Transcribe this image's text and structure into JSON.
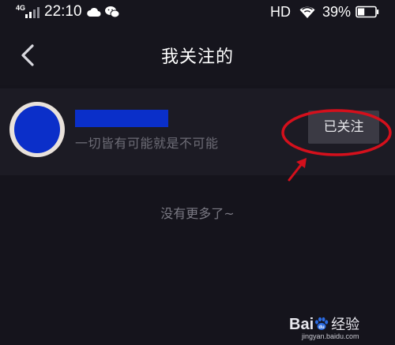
{
  "status_bar": {
    "network": "4G",
    "time": "22:10",
    "hd": "HD",
    "battery_percent": "39%",
    "battery_level": 0.39,
    "icons": [
      "signal-icon",
      "cloud-icon",
      "wechat-icon",
      "wifi-icon",
      "battery-icon"
    ]
  },
  "nav": {
    "back_icon": "chevron-left-icon",
    "title": "我关注的"
  },
  "list": {
    "items": [
      {
        "signature": "一切皆有可能就是不可能",
        "button_label": "已关注"
      }
    ]
  },
  "footer": {
    "no_more": "没有更多了~"
  },
  "watermark": {
    "logo": "Baidu经验",
    "url": "jingyan.baidu.com"
  },
  "colors": {
    "background": "#15141c",
    "item_background": "#1c1b24",
    "button_background": "#3b3a44",
    "annotation": "#d4101c",
    "redacted_blue": "#0a2fc9"
  }
}
